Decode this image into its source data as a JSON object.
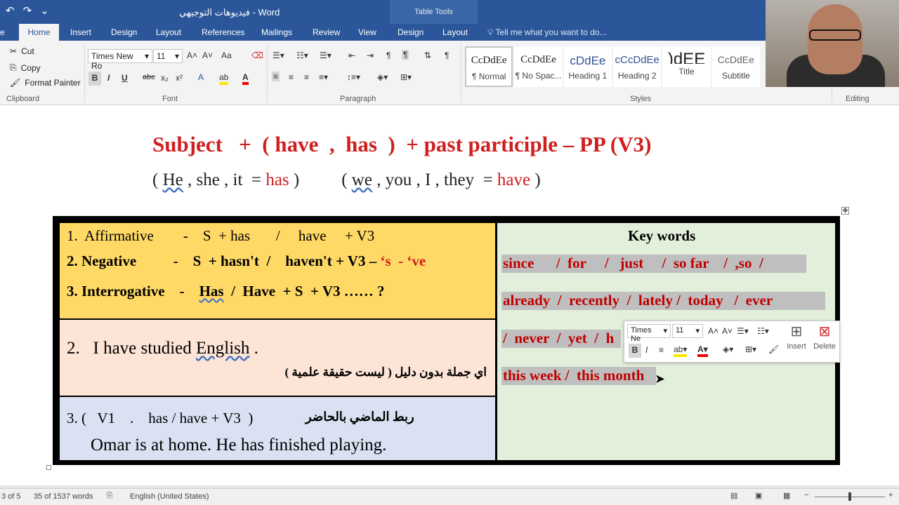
{
  "window": {
    "title": "فيديوهات التوجيهي - Word",
    "table_tools": "Table Tools"
  },
  "qat": {
    "undo": "↶",
    "redo": "↷",
    "customize": "⌄"
  },
  "tabs": [
    "Home",
    "Insert",
    "Design",
    "Layout",
    "References",
    "Mailings",
    "Review",
    "View",
    "Design",
    "Layout"
  ],
  "tell_me": "Tell me what you want to do...",
  "clipboard": {
    "cut": "Cut",
    "copy": "Copy",
    "format_painter": "Format Painter",
    "label": "Clipboard"
  },
  "font": {
    "name": "Times New Ro",
    "size": "11",
    "label": "Font",
    "bold": "B",
    "italic": "I",
    "underline": "U",
    "strike": "abc",
    "sub": "x₂",
    "sup": "x²",
    "case": "Aa"
  },
  "paragraph": {
    "label": "Paragraph"
  },
  "styles": {
    "label": "Styles",
    "items": [
      {
        "sample": "CcDdEe",
        "name": "¶ Normal"
      },
      {
        "sample": "CcDdEe",
        "name": "¶ No Spac..."
      },
      {
        "sample": "cDdEe",
        "name": "Heading 1"
      },
      {
        "sample": "cCcDdEe",
        "name": "Heading 2"
      },
      {
        "sample": ")dEE",
        "name": "Title"
      },
      {
        "sample": "CcDdEe",
        "name": "Subtitle"
      }
    ]
  },
  "editing": {
    "label": "Editing"
  },
  "document": {
    "heading": "Subject   +  ( have  ,  has  )  + past participle – PP (V3)",
    "subject_line": {
      "open1": "( ",
      "he": "He",
      "rest1": " , she , it  = ",
      "has": "has",
      "close1": " )",
      "open2": "( ",
      "we": "we",
      "rest2": " , you , I , they  = ",
      "have": "have",
      "close2": " )"
    },
    "table": {
      "affirmative": "1.  Affirmative        -    S  + has       /     have     + V3",
      "neg_prefix": "2. Negative          -    S  + hasn't  /    haven't + V3 – ",
      "neg_suffix": "‘s  - ‘ve",
      "interrog_prefix": "3. Interrogative    -    ",
      "interrog_has": "Has",
      "interrog_mid": "  /  Have  + S  + V3 …… ?",
      "example2_prefix": "2.   I have studied ",
      "example2_word": "English",
      "example2_suffix": " .",
      "example2_arabic": "اي جملة بدون دليل ( ليست حقيقة علمية )",
      "example3_title": "3. (   V1    .    has / have + V3  )",
      "example3_arabic": "ربط الماضي بالحاضر",
      "example3_sentence": "Omar is at home. He has finished playing.",
      "keywords_title": "Key words",
      "kw_line1": "since      /  for     /   just     /  so far    /  ,so  / ",
      "kw_line2": "already  /  recently  /  lately /  today   /  ever  ",
      "kw_line3": "/  never  /  yet  /  h",
      "kw_line4": "this week /  this month"
    }
  },
  "mini_toolbar": {
    "font": "Times Ne",
    "size": "11",
    "insert": "Insert",
    "delete": "Delete"
  },
  "status": {
    "page": "3 of 5",
    "words": "35 of 1537 words",
    "language": "English (United States)"
  }
}
